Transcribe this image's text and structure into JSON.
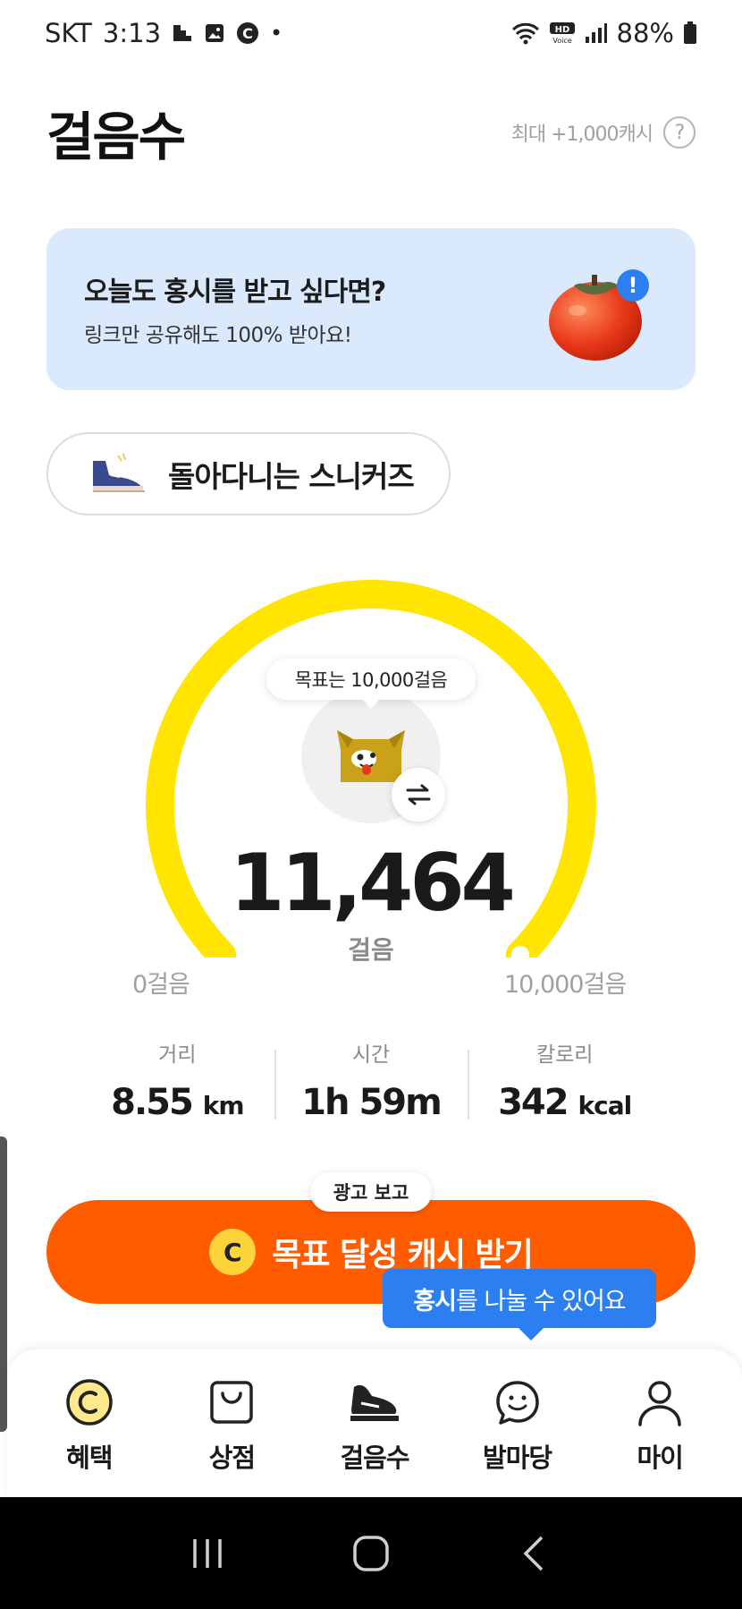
{
  "status_bar": {
    "carrier": "SKT",
    "time": "3:13",
    "battery": "88%",
    "icons": [
      "stairs-icon",
      "image-icon",
      "c-icon",
      "dot-icon",
      "wifi-icon",
      "hd-voice-icon",
      "signal-icon",
      "battery-icon"
    ]
  },
  "header": {
    "title": "걸음수",
    "max_cash": "최대 +1,000캐시",
    "help": "?"
  },
  "banner": {
    "title": "오늘도 홍시를 받고 싶다면?",
    "subtitle": "링크만 공유해도 100% 받아요!",
    "badge": "!"
  },
  "sneaker_chip": {
    "label": "돌아다니는 스니커즈"
  },
  "gauge": {
    "goal_bubble": "목표는 10,000걸음",
    "steps": "11,464",
    "unit": "걸음",
    "min_label": "0걸음",
    "max_label": "10,000걸음",
    "progress_fraction": 1.0,
    "color": "#FFE500"
  },
  "stats": [
    {
      "label": "거리",
      "value": "8.55",
      "unit": "km"
    },
    {
      "label": "시간",
      "value": "1h 59m",
      "unit": ""
    },
    {
      "label": "칼로리",
      "value": "342",
      "unit": "kcal"
    }
  ],
  "cta": {
    "ad_label": "광고 보고",
    "coin": "C",
    "label": "목표 달성 캐시 받기",
    "color": "#FF5C00"
  },
  "tooltip": {
    "bold": "홍시",
    "rest": "를 나눌 수 있어요"
  },
  "tabs": [
    {
      "label": "혜택",
      "icon": "coin-tab-icon"
    },
    {
      "label": "상점",
      "icon": "shopping-bag-icon"
    },
    {
      "label": "걸음수",
      "icon": "shoe-icon",
      "active": true
    },
    {
      "label": "발마당",
      "icon": "chat-smile-icon"
    },
    {
      "label": "마이",
      "icon": "person-icon"
    }
  ]
}
